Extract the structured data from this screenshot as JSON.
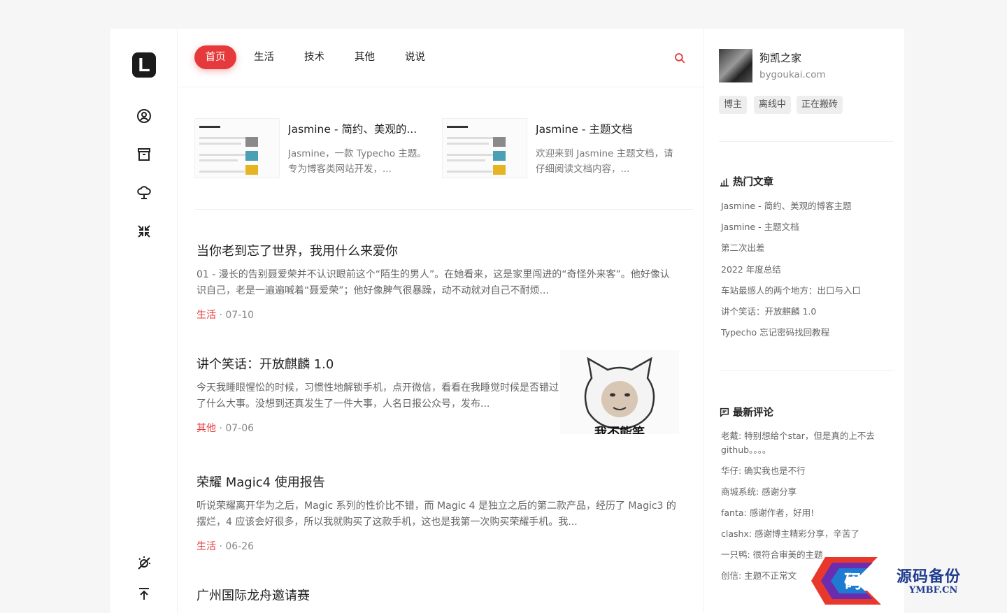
{
  "brand": {
    "logo_letter": "L"
  },
  "nav": {
    "items": [
      "首页",
      "生活",
      "技术",
      "其他",
      "说说"
    ],
    "active_index": 0
  },
  "featured": [
    {
      "title": "Jasmine - 简约、美观的...",
      "desc": "Jasmine，一款 Typecho 主题。专为博客类网站开发，..."
    },
    {
      "title": "Jasmine - 主题文档",
      "desc": "欢迎来到 Jasmine 主题文档，请仔细阅读文档内容，..."
    }
  ],
  "posts": [
    {
      "title": "当你老到忘了世界，我用什么来爱你",
      "excerpt": "01 - 漫长的告别聂爱荣并不认识眼前这个“陌生的男人”。在她看来，这是家里闯进的“奇怪外来客”。他好像认识自己，老是一遍遍喊着“聂爱荣”；他好像脾气很暴躁，动不动就对自己不耐烦...",
      "category": "生活",
      "date": "07-10"
    },
    {
      "title": "讲个笑话：开放麒麟 1.0",
      "excerpt": "今天我睡眼惺忪的时候，习惯性地解锁手机，点开微信，看看在我睡觉时候是否错过了什么大事。没想到还真发生了一件大事，人名日报公众号，发布...",
      "category": "其他",
      "date": "07-06",
      "cover_caption": "我不能笑"
    },
    {
      "title": "荣耀 Magic4 使用报告",
      "excerpt": "听说荣耀离开华为之后，Magic 系列的性价比不错，而 Magic 4 是独立之后的第二款产品，经历了 Magic3 的摆烂，4 应该会好很多，所以我就购买了这款手机，这也是我第一次购买荣耀手机。我...",
      "category": "生活",
      "date": "06-26"
    },
    {
      "title": "广州国际龙舟邀请赛"
    }
  ],
  "meta_separator": " · ",
  "author": {
    "name": "狗凯之家",
    "site": "bygoukai.com",
    "tags": [
      "博主",
      "离线中",
      "正在搬砖"
    ]
  },
  "hot": {
    "heading": "热门文章",
    "items": [
      "Jasmine - 简约、美观的博客主题",
      "Jasmine - 主题文档",
      "第二次出差",
      "2022 年度总结",
      "车站最感人的两个地方：出口与入口",
      "讲个笑话：开放麒麟 1.0",
      "Typecho 忘记密码找回教程"
    ]
  },
  "comments": {
    "heading": "最新评论",
    "items": [
      "老戴: 特别想给个star，但是真的上不去github。。。。",
      "华仔: 确实我也是不行",
      "商城系统: 感谢分享",
      "fanta: 感谢作者，好用!",
      "clashx: 感谢博主精彩分享，辛苦了",
      "一只鸭: 很符合审美的主题",
      "创信: 主题不正常文"
    ]
  },
  "watermark": {
    "text": "源码备份",
    "sub": "YMBF.CN",
    "logo_char": "码"
  },
  "colors": {
    "accent": "#e5393b",
    "text": "#222222",
    "muted": "#666666"
  }
}
